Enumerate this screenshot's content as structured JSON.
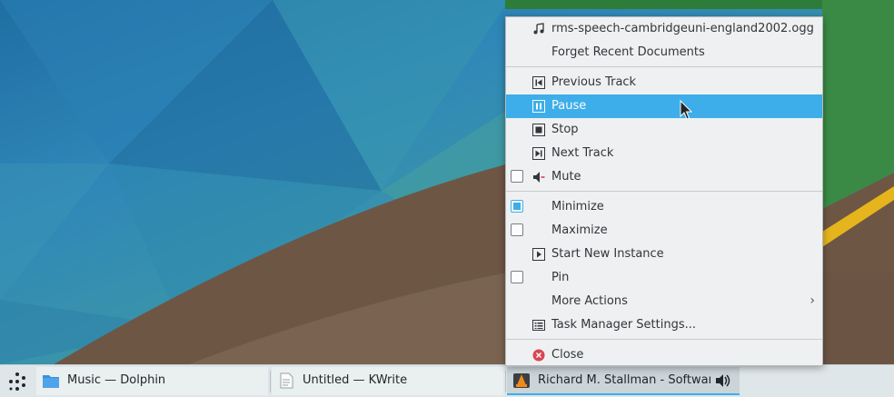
{
  "taskbar": {
    "tasks": [
      {
        "label": "Music — Dolphin",
        "icon": "folder-icon"
      },
      {
        "label": "Untitled  — KWrite",
        "icon": "text-document-icon"
      },
      {
        "label": "Richard M. Stallman - Softwar...",
        "icon": "vlc-icon",
        "audio_icon": "speaker-icon"
      }
    ]
  },
  "menu": {
    "recent_document": "rms-speech-cambridgeuni-england2002.ogg",
    "forget_recent": "Forget Recent Documents",
    "previous_track": "Previous Track",
    "pause": "Pause",
    "stop": "Stop",
    "next_track": "Next Track",
    "mute": "Mute",
    "minimize": "Minimize",
    "maximize": "Maximize",
    "start_new_instance": "Start New Instance",
    "pin": "Pin",
    "more_actions": "More Actions",
    "task_manager_settings": "Task Manager Settings...",
    "close": "Close"
  },
  "state": {
    "mute_checked": false,
    "minimize_checked": true,
    "maximize_checked": false,
    "pin_checked": false,
    "highlighted_item": "Pause"
  },
  "colors": {
    "accent": "#3daee9",
    "close_red": "#da4453",
    "menu_bg": "#eff0f1",
    "taskbar_bg": "#dfe6e9"
  }
}
